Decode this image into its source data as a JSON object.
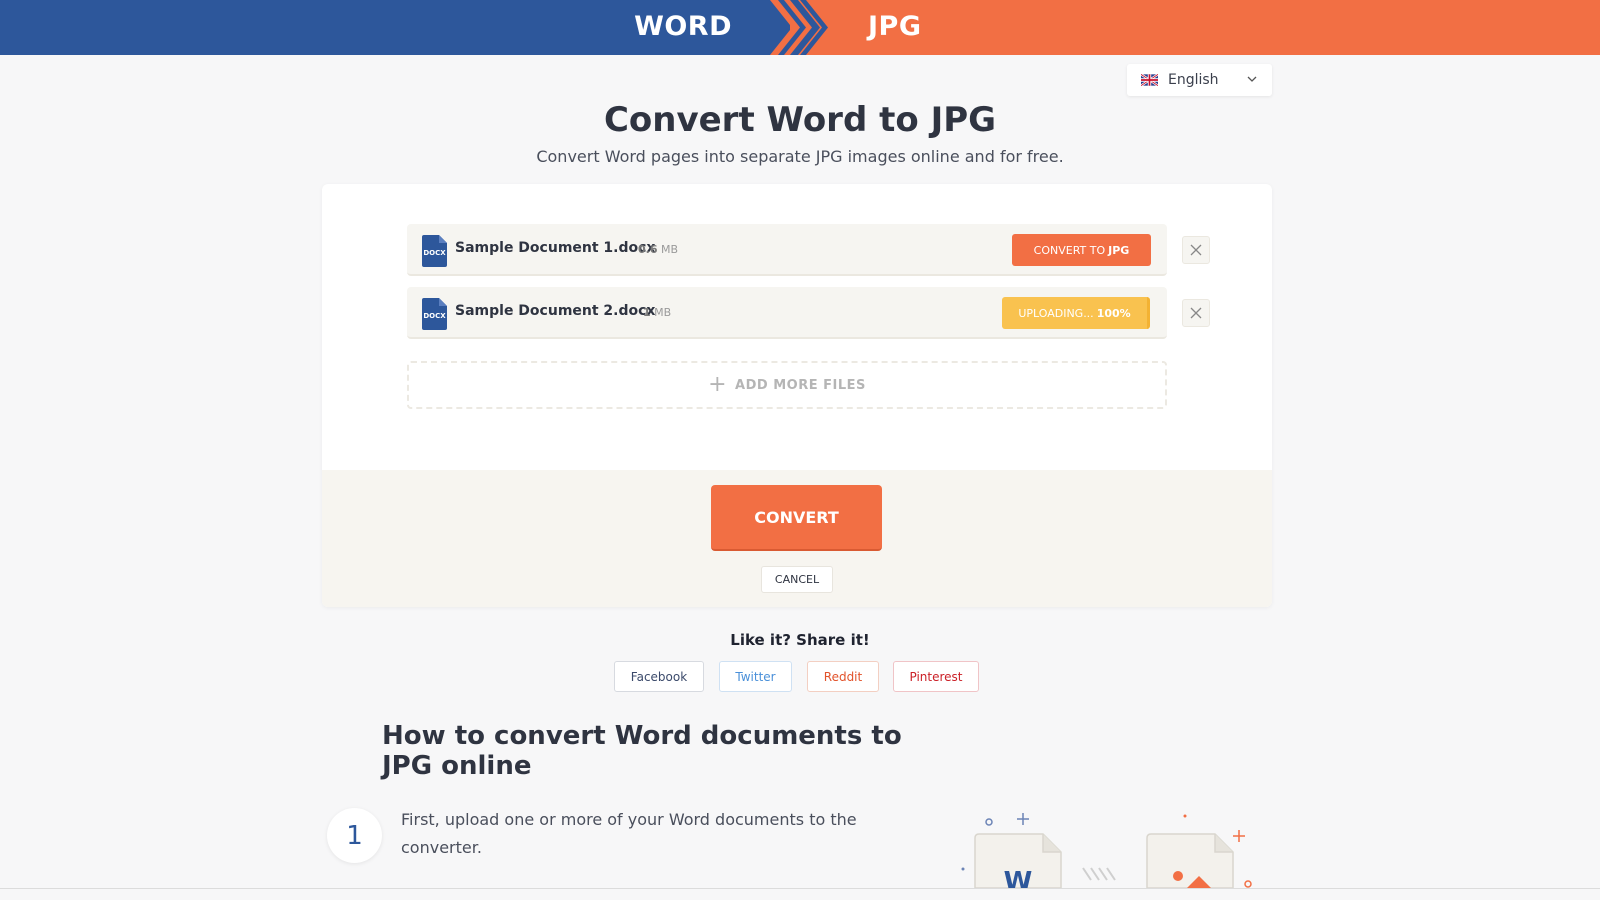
{
  "banner": {
    "from": "WORD",
    "to": "JPG",
    "left_color": "#2d579b",
    "right_color": "#f26f44"
  },
  "language": {
    "selected": "English",
    "icon": "uk-flag-icon"
  },
  "page": {
    "title": "Convert Word to JPG",
    "subtitle": "Convert Word pages into separate JPG images online and for free."
  },
  "files": [
    {
      "name": "Sample Document 1.docx",
      "size_value": "0.6",
      "size_unit": "MB",
      "action_prefix": "CONVERT TO",
      "action_format": "JPG",
      "status": "ready"
    },
    {
      "name": "Sample Document 2.docx",
      "size_value": "1",
      "size_unit": "MB",
      "upload_prefix": "UPLOADING...",
      "upload_percent": "100%",
      "status": "uploading"
    }
  ],
  "file_icon_label": "DOCX",
  "add_more": {
    "label": "ADD MORE FILES"
  },
  "actions": {
    "convert": "CONVERT",
    "cancel": "CANCEL"
  },
  "share": {
    "title": "Like it? Share it!",
    "buttons": [
      "Facebook",
      "Twitter",
      "Reddit",
      "Pinterest"
    ]
  },
  "howto": {
    "title": "How to convert Word documents to JPG online",
    "steps": [
      {
        "number": "1",
        "text": "First, upload one or more of your Word documents to the converter."
      }
    ]
  },
  "colors": {
    "accent": "#f26f44",
    "word_blue": "#2d579b",
    "upload_yellow": "#f9c24f"
  }
}
